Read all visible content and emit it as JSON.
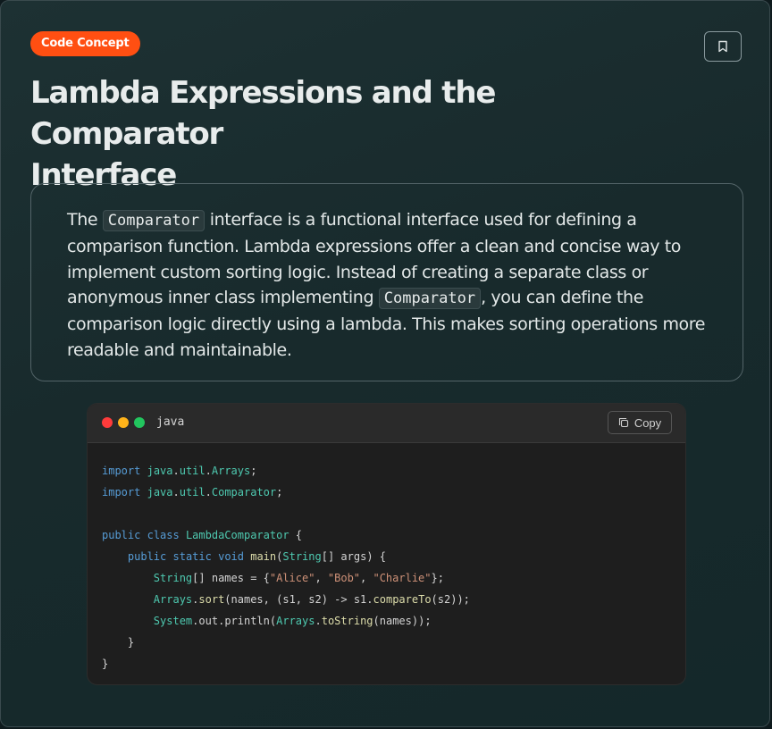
{
  "badge": "Code Concept",
  "title_line1": "Lambda Expressions and the Comparator",
  "title_line2": "Interface",
  "description": {
    "t1": "The ",
    "c1": "Comparator",
    "t2": " interface is a functional interface used for defining a comparison function. Lambda expressions offer a clean and concise way to implement custom sorting logic. Instead of creating a separate class or anonymous inner class implementing ",
    "c2": "Comparator",
    "t3": ", you can define the comparison logic directly using a lambda. This makes sorting operations more readable and maintainable."
  },
  "code": {
    "language": "java",
    "copy_label": "Copy",
    "s": {
      "import": "import",
      "java": "java",
      "util": "util",
      "Arrays": "Arrays",
      "Comparator": "Comparator",
      "public": "public",
      "class": "class",
      "LambdaComparator": "LambdaComparator",
      "static": "static",
      "void": "void",
      "main": "main",
      "String": "String",
      "args": "args",
      "names": "names",
      "Alice": "\"Alice\"",
      "Bob": "\"Bob\"",
      "Charlie": "\"Charlie\"",
      "sort": "sort",
      "s1": "s1",
      "s2": "s2",
      "compareTo": "compareTo",
      "System": "System",
      "out": "out",
      "println": "println",
      "toString": "toString"
    }
  },
  "colors": {
    "badge": "#ff4f12",
    "keyword": "#569cd6",
    "type": "#4ec9b0",
    "function": "#dcdcaa",
    "string": "#ce9178"
  },
  "icons": {
    "bookmark": "bookmark-icon",
    "copy": "copy-icon"
  }
}
